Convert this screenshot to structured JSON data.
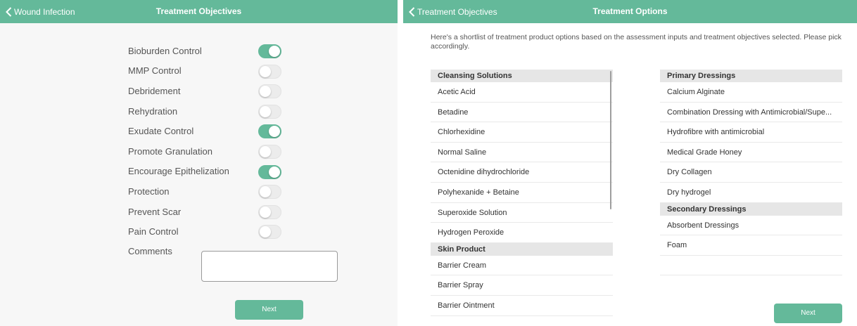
{
  "left_screen": {
    "nav": {
      "back_label": "Wound Infection",
      "title": "Treatment Objectives"
    },
    "objectives": [
      {
        "label": "Bioburden Control",
        "on": true
      },
      {
        "label": "MMP Control",
        "on": false
      },
      {
        "label": "Debridement",
        "on": false
      },
      {
        "label": "Rehydration",
        "on": false
      },
      {
        "label": "Exudate Control",
        "on": true
      },
      {
        "label": "Promote Granulation",
        "on": false
      },
      {
        "label": "Encourage Epithelization",
        "on": true
      },
      {
        "label": "Protection",
        "on": false
      },
      {
        "label": "Prevent Scar",
        "on": false
      },
      {
        "label": "Pain Control",
        "on": false
      }
    ],
    "comments_label": "Comments",
    "comments_value": "",
    "next_label": "Next"
  },
  "right_screen": {
    "nav": {
      "back_label": "Treatment Objectives",
      "title": "Treatment Options"
    },
    "intro": "Here's a shortlist of treatment product options based on the assessment inputs and treatment objectives selected. Please pick accordingly.",
    "left_column": {
      "cleansing": {
        "header": "Cleansing Solutions",
        "items": [
          "Acetic Acid",
          "Betadine",
          "Chlorhexidine",
          "Normal Saline",
          "Octenidine dihydrochloride",
          "Polyhexanide + Betaine",
          "Superoxide Solution",
          "Hydrogen Peroxide"
        ]
      },
      "skin": {
        "header": "Skin Product",
        "items": [
          "Barrier Cream",
          "Barrier Spray",
          "Barrier Ointment"
        ]
      }
    },
    "right_column": {
      "primary": {
        "header": "Primary Dressings",
        "items": [
          "Calcium Alginate",
          "Combination Dressing with Antimicrobial/Supe...",
          "Hydrofibre with antimicrobial",
          "Medical Grade Honey",
          "Dry Collagen",
          "Dry hydrogel"
        ]
      },
      "secondary": {
        "header": "Secondary Dressings",
        "items": [
          "Absorbent Dressings",
          "Foam"
        ]
      }
    },
    "next_label": "Next"
  },
  "colors": {
    "accent": "#64b99a",
    "section_bg": "#e6e6e6",
    "toggle_off": "#ececec"
  },
  "icons": {
    "back": "chevron-left-icon"
  }
}
